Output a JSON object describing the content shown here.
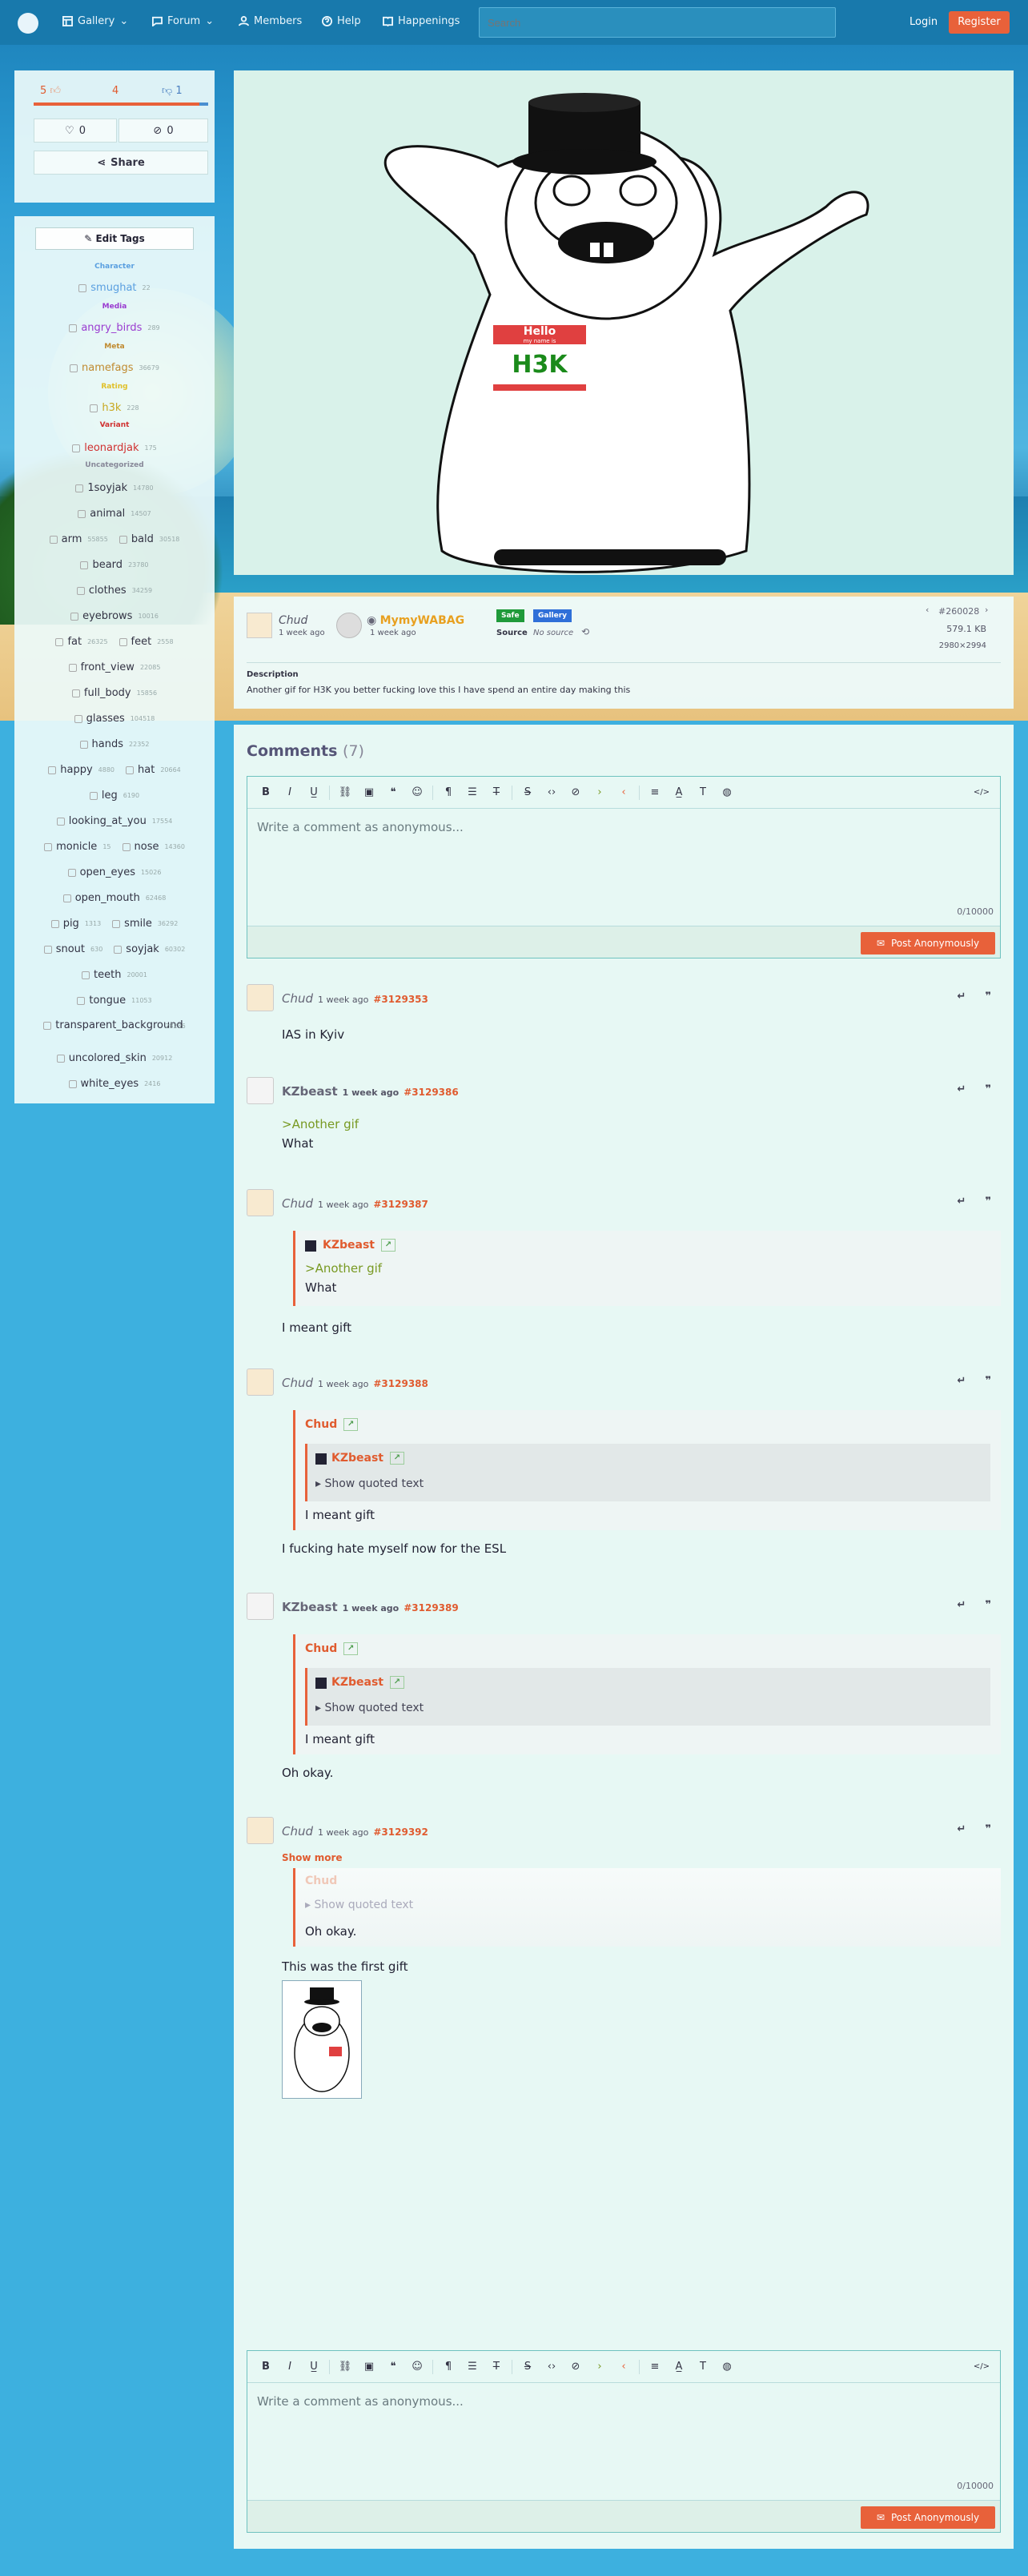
{
  "nav": {
    "items": [
      {
        "label": "Gallery"
      },
      {
        "label": "Forum"
      },
      {
        "label": "Members"
      },
      {
        "label": "Help"
      },
      {
        "label": "Happenings"
      }
    ],
    "search_placeholder": "Search",
    "login": "Login",
    "register": "Register"
  },
  "votes": {
    "up": "5",
    "score": "4",
    "down": "1",
    "favorites": "0",
    "hidden": "0",
    "share": "Share"
  },
  "tags": {
    "edit": "Edit Tags",
    "categories": {
      "character": "Character",
      "media": "Media",
      "meta": "Meta",
      "rating": "Rating",
      "variant": "Variant",
      "uncategorized": "Uncategorized"
    },
    "list": [
      {
        "name": "smughat",
        "count": "22"
      },
      {
        "name": "angry_birds",
        "count": "289"
      },
      {
        "name": "namefags",
        "count": "36679"
      },
      {
        "name": "h3k",
        "count": "228"
      },
      {
        "name": "leonardjak",
        "count": "175"
      },
      {
        "name": "1soyjak",
        "count": "14780"
      },
      {
        "name": "animal",
        "count": "14507"
      },
      {
        "name": "arm",
        "count": "55855"
      },
      {
        "name": "bald",
        "count": "30518"
      },
      {
        "name": "beard",
        "count": "23780"
      },
      {
        "name": "clothes",
        "count": "34259"
      },
      {
        "name": "eyebrows",
        "count": "10016"
      },
      {
        "name": "fat",
        "count": "26325"
      },
      {
        "name": "feet",
        "count": "2558"
      },
      {
        "name": "front_view",
        "count": "22085"
      },
      {
        "name": "full_body",
        "count": "15856"
      },
      {
        "name": "glasses",
        "count": "104518"
      },
      {
        "name": "hands",
        "count": "22352"
      },
      {
        "name": "happy",
        "count": "4880"
      },
      {
        "name": "hat",
        "count": "20664"
      },
      {
        "name": "leg",
        "count": "6190"
      },
      {
        "name": "looking_at_you",
        "count": "17554"
      },
      {
        "name": "monicle",
        "count": "15"
      },
      {
        "name": "nose",
        "count": "14360"
      },
      {
        "name": "open_eyes",
        "count": "15026"
      },
      {
        "name": "open_mouth",
        "count": "62468"
      },
      {
        "name": "pig",
        "count": "1313"
      },
      {
        "name": "smile",
        "count": "36292"
      },
      {
        "name": "snout",
        "count": "630"
      },
      {
        "name": "soyjak",
        "count": "60302"
      },
      {
        "name": "teeth",
        "count": "20001"
      },
      {
        "name": "tongue",
        "count": "11053"
      },
      {
        "name": "transparent_background",
        "count": "28236"
      },
      {
        "name": "uncolored_skin",
        "count": "20912"
      },
      {
        "name": "white_eyes",
        "count": "2416"
      }
    ]
  },
  "image": {
    "hello": "Hello",
    "myname": "my name is",
    "name": "H3K"
  },
  "post": {
    "uploader": "Chud",
    "uploader_time": "1 week ago",
    "artist": "MymyWABAG",
    "artist_time": "1 week ago",
    "rating": "Safe",
    "type": "Gallery",
    "source_label": "Source",
    "source_value": "No source",
    "id": "#260028",
    "size": "579.1 KB",
    "dims": "2980×2994",
    "desc_label": "Description",
    "description": "Another gif for H3K you better fucking love this I have spend an entire day making this"
  },
  "comments_header": {
    "title": "Comments",
    "count": "(7)"
  },
  "editor": {
    "placeholder": "Write a comment as anonymous...",
    "counter": "0/10000",
    "post": "Post Anonymously"
  },
  "comments": [
    {
      "name": "Chud",
      "time": "1 week ago",
      "id": "#3129353",
      "body": "IAS in Kyiv"
    },
    {
      "name": "KZbeast",
      "time": "1 week ago",
      "id": "#3129386",
      "green": ">Another gif",
      "body": "What"
    },
    {
      "name": "Chud",
      "time": "1 week ago",
      "id": "#3129387",
      "q_name": "KZbeast",
      "q_green": ">Another gif",
      "q_body": "What",
      "body": "I meant gift"
    },
    {
      "name": "Chud",
      "time": "1 week ago",
      "id": "#3129388",
      "q_name": "Chud",
      "q_inner": "KZbeast",
      "q_show": "Show quoted text",
      "q_body": "I meant gift",
      "body": "I fucking hate myself now for the ESL"
    },
    {
      "name": "KZbeast",
      "time": "1 week ago",
      "id": "#3129389",
      "q_name": "Chud",
      "q_inner": "KZbeast",
      "q_show": "Show quoted text",
      "q_body": "I meant gift",
      "body": "Oh okay."
    },
    {
      "name": "Chud",
      "time": "1 week ago",
      "id": "#3129392",
      "show_more": "Show more",
      "q_name": "Chud",
      "q_show": "Show quoted text",
      "q_body": "Oh okay.",
      "body": "This was the first gift"
    }
  ],
  "colors": {
    "accent": "#e8613a",
    "nav": "#1878aa",
    "panel": "#ecfafa"
  }
}
